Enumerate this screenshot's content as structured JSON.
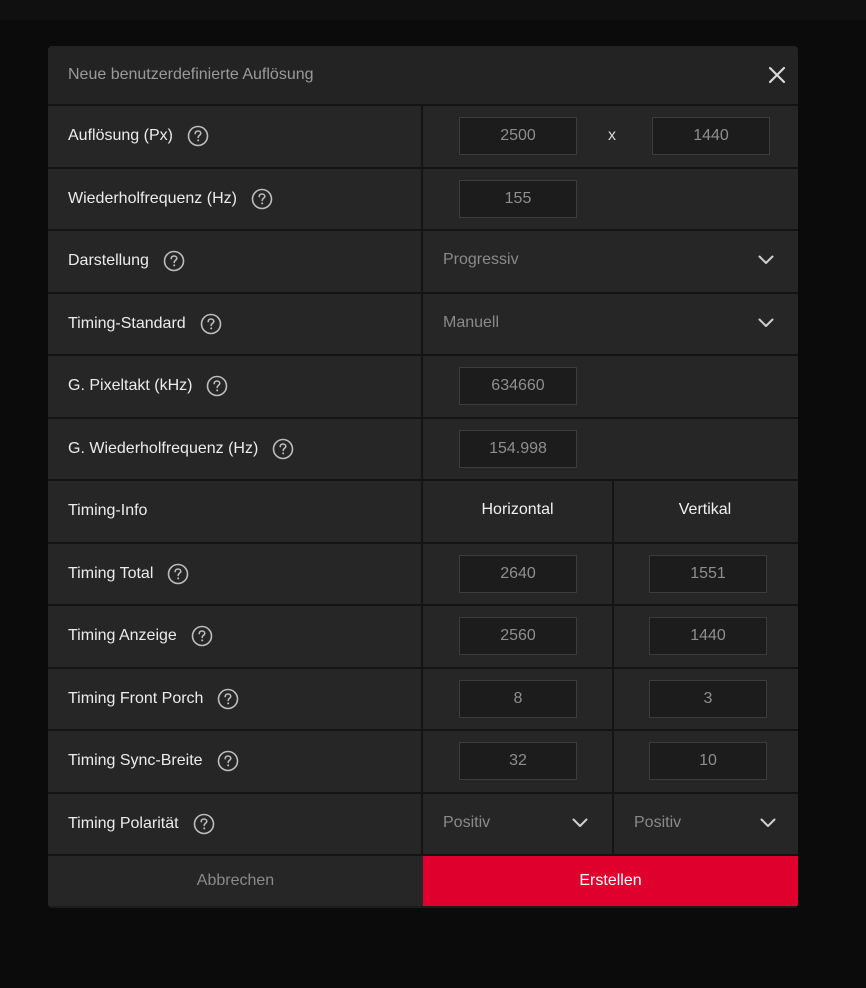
{
  "dialog": {
    "title": "Neue benutzerdefinierte Auflösung",
    "close_icon": "close-icon"
  },
  "rows": {
    "resolution": {
      "label": "Auflösung (Px)",
      "width": "2500",
      "separator": "x",
      "height": "1440"
    },
    "refresh": {
      "label": "Wiederholfrequenz (Hz)",
      "value": "155"
    },
    "display": {
      "label": "Darstellung",
      "selected": "Progressiv"
    },
    "timing_standard": {
      "label": "Timing-Standard",
      "selected": "Manuell"
    },
    "pixel_clock": {
      "label": "G. Pixeltakt (kHz)",
      "value": "634660"
    },
    "g_refresh": {
      "label": "G. Wiederholfrequenz (Hz)",
      "value": "154.998"
    },
    "timing_info": {
      "label": "Timing-Info",
      "col_h": "Horizontal",
      "col_v": "Vertikal"
    },
    "timing_total": {
      "label": "Timing Total",
      "h": "2640",
      "v": "1551"
    },
    "timing_display": {
      "label": "Timing Anzeige",
      "h": "2560",
      "v": "1440"
    },
    "front_porch": {
      "label": "Timing Front Porch",
      "h": "8",
      "v": "3"
    },
    "sync_width": {
      "label": "Timing Sync-Breite",
      "h": "32",
      "v": "10"
    },
    "polarity": {
      "label": "Timing Polarität",
      "h": "Positiv",
      "v": "Positiv"
    }
  },
  "footer": {
    "cancel": "Abbrechen",
    "create": "Erstellen"
  },
  "colors": {
    "accent": "#e0002e",
    "panel": "#262626",
    "background": "#0b0b0b"
  }
}
